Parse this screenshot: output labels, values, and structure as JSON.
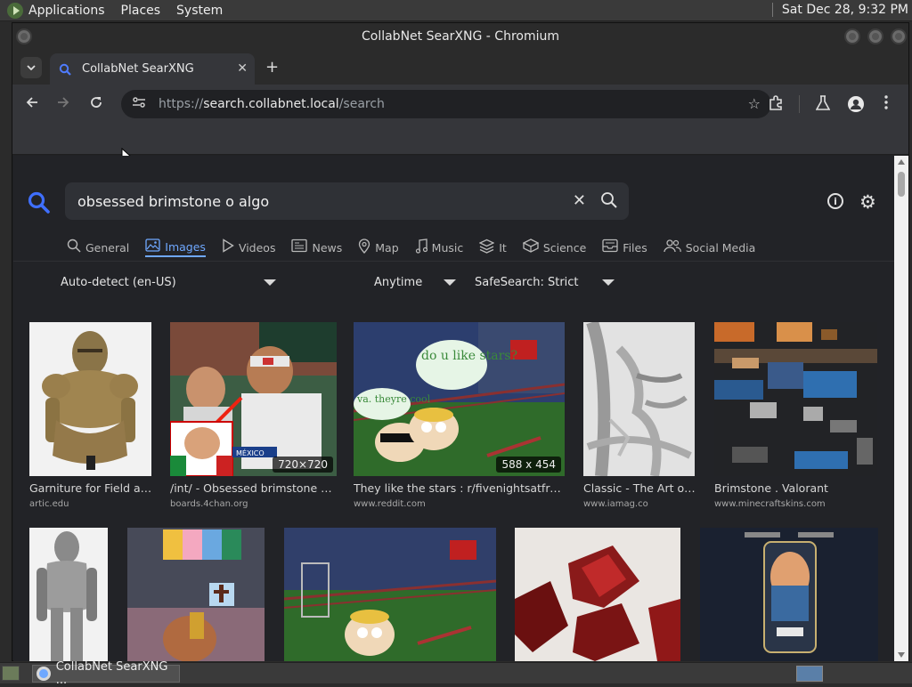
{
  "os": {
    "menus": [
      "Applications",
      "Places",
      "System"
    ],
    "clock": "Sat Dec 28,  9:32 PM"
  },
  "window": {
    "title": "CollabNet SearXNG - Chromium"
  },
  "browser": {
    "tab_title": "CollabNet SearXNG",
    "url_scheme": "https://",
    "url_host": "search.collabnet.local",
    "url_path": "/search"
  },
  "search": {
    "query": "obsessed brimstone o algo",
    "categories": [
      {
        "label": "General",
        "icon": "search-icon"
      },
      {
        "label": "Images",
        "icon": "image-icon",
        "active": true
      },
      {
        "label": "Videos",
        "icon": "play-icon"
      },
      {
        "label": "News",
        "icon": "newspaper-icon"
      },
      {
        "label": "Map",
        "icon": "map-pin-icon"
      },
      {
        "label": "Music",
        "icon": "music-icon"
      },
      {
        "label": "It",
        "icon": "layers-icon"
      },
      {
        "label": "Science",
        "icon": "cube-icon"
      },
      {
        "label": "Files",
        "icon": "inbox-icon"
      },
      {
        "label": "Social Media",
        "icon": "users-icon"
      }
    ],
    "filters": {
      "language": "Auto-detect (en-US)",
      "time": "Anytime",
      "safesearch": "SafeSearch: Strict"
    }
  },
  "results": [
    {
      "title": "Garniture for Field and Tournament",
      "source": "artic.edu"
    },
    {
      "title": "/int/ - Obsessed brimstone - International",
      "source": "boards.4chan.org",
      "resolution": "720×720"
    },
    {
      "title": "They like the stars : r/fivenightsatfreddys",
      "source": "www.reddit.com",
      "resolution": "588 x 454"
    },
    {
      "title": "Classic - The Art of Brimstone",
      "source": "www.iamag.co"
    },
    {
      "title": "Brimstone . Valorant",
      "source": "www.minecraftskins.com"
    }
  ],
  "comic": {
    "bubble1": "do u like stars?",
    "bubble2": "va. theyre cool"
  },
  "meme": {
    "mexico_label": "MÉXICO"
  },
  "taskbar": {
    "task_label": "CollabNet SearXNG ..."
  }
}
